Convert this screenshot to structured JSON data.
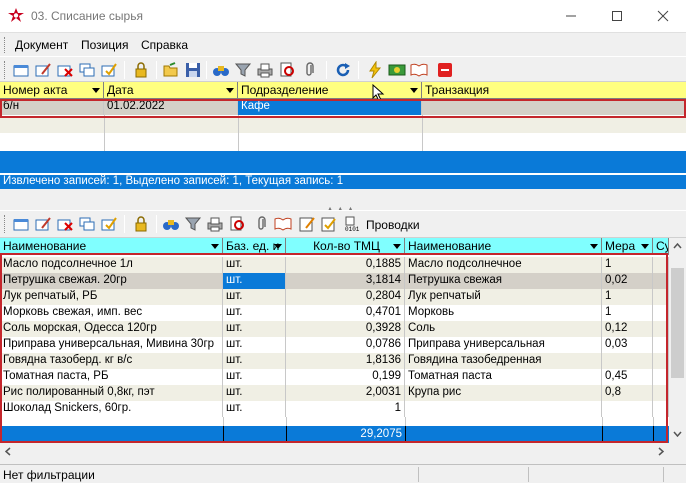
{
  "window": {
    "title": "03. Списание сырья"
  },
  "menu": {
    "items": [
      "Документ",
      "Позиция",
      "Справка"
    ]
  },
  "top_grid": {
    "columns": [
      "Номер акта",
      "Дата",
      "Подразделение",
      "Транзакция"
    ],
    "rows": [
      {
        "number": "б/н",
        "date": "01.02.2022",
        "department": "Кафе",
        "transaction": ""
      }
    ],
    "status": "Извлечено записей: 1, Выделено записей: 1, Текущая запись: 1"
  },
  "bottom_toolbar": {
    "postings_label": "Проводки"
  },
  "bottom_grid": {
    "columns": [
      "Наименование",
      "Баз. ед. и",
      "Кол-во ТМЦ",
      "Наименование",
      "Мера",
      "Су"
    ],
    "rows": [
      {
        "name": "Масло подсолнечное 1л",
        "unit": "шт.",
        "qty": "0,1885",
        "name2": "Масло подсолнечное",
        "measure": "1"
      },
      {
        "name": "Петрушка свежая. 20гр",
        "unit": "шт.",
        "qty": "3,1814",
        "name2": "Петрушка свежая",
        "measure": "0,02"
      },
      {
        "name": "Лук репчатый, РБ",
        "unit": "шт.",
        "qty": "0,2804",
        "name2": "Лук репчатый",
        "measure": "1"
      },
      {
        "name": "Морковь свежая, имп. вес",
        "unit": "шт.",
        "qty": "0,4701",
        "name2": "Морковь",
        "measure": "1"
      },
      {
        "name": "Соль морская, Одесса 120гр",
        "unit": "шт.",
        "qty": "0,3928",
        "name2": "Соль",
        "measure": "0,12"
      },
      {
        "name": "Приправа универсальная, Мивина 30гр",
        "unit": "шт.",
        "qty": "0,0786",
        "name2": "Приправа универсальная",
        "measure": "0,03"
      },
      {
        "name": "Говядна тазоберд. кг в/с",
        "unit": "шт.",
        "qty": "1,8136",
        "name2": "Говядина тазобедренная",
        "measure": ""
      },
      {
        "name": "Томатная паста, РБ",
        "unit": "шт.",
        "qty": "0,199",
        "name2": "Томатная паста",
        "measure": "0,45"
      },
      {
        "name": "Рис полированный 0,8кг, пэт",
        "unit": "шт.",
        "qty": "2,0031",
        "name2": "Крупа рис",
        "measure": "0,8"
      },
      {
        "name": "Шоколад Snickers, 60гр.",
        "unit": "шт.",
        "qty": "1",
        "name2": "",
        "measure": ""
      }
    ],
    "total": "29,2075"
  },
  "statusbar": {
    "text": "Нет фильтрации"
  },
  "colors": {
    "selection": "#0a7ad8",
    "header_yellow": "#ffff80",
    "header_cyan": "#80ffff",
    "highlight_red": "#c4262c"
  }
}
